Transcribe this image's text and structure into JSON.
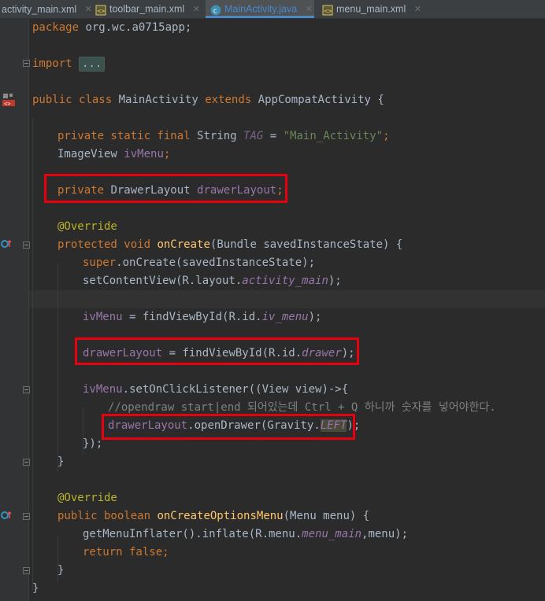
{
  "tabs": [
    {
      "label": "activity_main.xml",
      "type": "xml",
      "active": false
    },
    {
      "label": "toolbar_main.xml",
      "type": "xml",
      "active": false
    },
    {
      "label": "MainActivity.java",
      "type": "java",
      "active": true
    },
    {
      "label": "menu_main.xml",
      "type": "xml",
      "active": false
    }
  ],
  "code": {
    "l1": {
      "kw": "package",
      "rest": " org.wc.a0715app;"
    },
    "l2": {
      "kw": "import",
      "chip": "..."
    },
    "l3": {
      "kw1": "public",
      "kw2": "class",
      "name": "MainActivity",
      "kw3": "extends",
      "sup": "AppCompatActivity {"
    },
    "l4": {
      "kw": "private static final",
      "type": "String",
      "fld": "TAG",
      "eq": " = ",
      "str": "\"Main_Activity\"",
      "semi": ";"
    },
    "l5": {
      "type": "ImageView",
      "fld": "ivMenu",
      "semi": ";"
    },
    "l6": {
      "kw": "private",
      "type": "DrawerLayout",
      "fld": "drawerLayout",
      "semi": ";"
    },
    "l7": {
      "ann": "@Override"
    },
    "l8": {
      "kw": "protected void",
      "meth": "onCreate",
      "rest": "(Bundle savedInstanceState) {"
    },
    "l9": {
      "kw": "super",
      "rest": ".onCreate(savedInstanceState);"
    },
    "l10": {
      "pre": "setContentView(R.layout.",
      "ifld": "activity_main",
      "post": ");"
    },
    "l11": {
      "fld": "ivMenu",
      "pre": " = findViewById(R.id.",
      "ifld": "iv_menu",
      "post": ");"
    },
    "l12": {
      "fld": "drawerLayout",
      "pre": " = findViewById(R.id.",
      "ifld": "drawer",
      "post": ");"
    },
    "l13": {
      "fld": "ivMenu",
      "rest": ".setOnClickListener((View view)->{"
    },
    "l14": {
      "cmt": "//opendraw start|end 되어있는데 Ctrl + Q 하니까 숫자를 넣어야한다."
    },
    "l15": {
      "fld": "drawerLayout",
      "pre": ".openDrawer(Gravity.",
      "ifld": "LEFT",
      "post": ");"
    },
    "l16": {
      "text": "});"
    },
    "l17": {
      "text": "}"
    },
    "l18": {
      "ann": "@Override"
    },
    "l19": {
      "kw": "public boolean",
      "meth": "onCreateOptionsMenu",
      "rest": "(Menu menu) {"
    },
    "l20": {
      "pre": "getMenuInflater().inflate(R.menu.",
      "ifld": "menu_main",
      "post": ",menu);"
    },
    "l21": {
      "kw": "return false",
      "semi": ";"
    },
    "l22": {
      "text": "}"
    },
    "l23": {
      "text": "}"
    }
  },
  "colors": {
    "background": "#2b2b2b",
    "keyword": "#cc7832",
    "field": "#9876aa",
    "string": "#6a8759",
    "annotation": "#bbb529",
    "method": "#ffc66d",
    "comment": "#808080",
    "highlight_box": "#e8000e"
  }
}
